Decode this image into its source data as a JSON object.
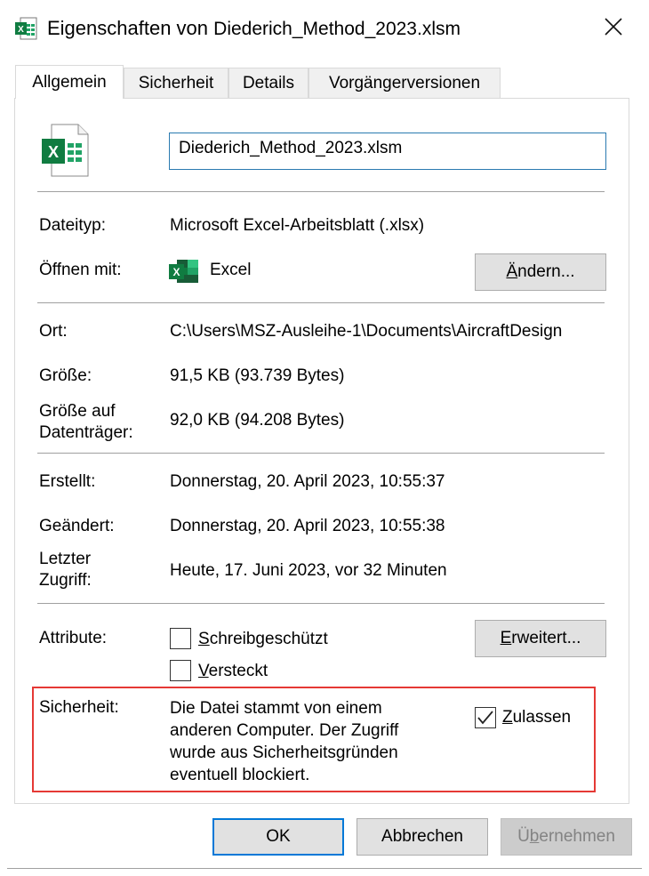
{
  "window": {
    "title_prefix": "Eigenschaften von",
    "title_file": "Diederich_Method_2023.xlsm"
  },
  "tabs": [
    {
      "label": "Allgemein"
    },
    {
      "label": "Sicherheit"
    },
    {
      "label": "Details"
    },
    {
      "label": "Vorgängerversionen"
    }
  ],
  "general": {
    "filename": "Diederich_Method_2023.xlsm",
    "filetype_label": "Dateityp:",
    "filetype_value": "Microsoft Excel-Arbeitsblatt (.xlsx)",
    "openwith_label": "Öffnen mit:",
    "openwith_value": "Excel",
    "change_button": {
      "pre": "",
      "acc": "Ä",
      "post": "ndern..."
    },
    "location_label": "Ort:",
    "location_value": "C:\\Users\\MSZ-Ausleihe-1\\Documents\\AircraftDesign",
    "size_label": "Größe:",
    "size_value": "91,5 KB (93.739 Bytes)",
    "disksize_label_1": "Größe auf",
    "disksize_label_2": "Datenträger:",
    "disksize_value": "92,0 KB (94.208 Bytes)",
    "created_label": "Erstellt:",
    "created_value": "Donnerstag, 20. April 2023, 10:55:37",
    "modified_label": "Geändert:",
    "modified_value": "Donnerstag, 20. April 2023, 10:55:38",
    "accessed_label_1": "Letzter",
    "accessed_label_2": "Zugriff:",
    "accessed_value": "Heute, 17. Juni 2023, vor 32 Minuten",
    "attributes_label": "Attribute:",
    "readonly": {
      "acc": "S",
      "post": "chreibgeschützt",
      "checked": false
    },
    "hidden": {
      "acc": "V",
      "post": "ersteckt",
      "checked": false
    },
    "advanced_button": {
      "acc": "E",
      "post": "rweitert..."
    },
    "security_label": "Sicherheit:",
    "security_text": [
      "Die Datei stammt von einem",
      "anderen Computer. Der Zugriff",
      "wurde aus Sicherheitsgründen",
      "eventuell blockiert."
    ],
    "unblock": {
      "acc": "Z",
      "post": "ulassen",
      "checked": true
    }
  },
  "footer": {
    "ok": "OK",
    "cancel": "Abbrechen",
    "apply": {
      "pre": "Ü",
      "acc": "b",
      "post": "ernehmen",
      "disabled": true
    }
  }
}
